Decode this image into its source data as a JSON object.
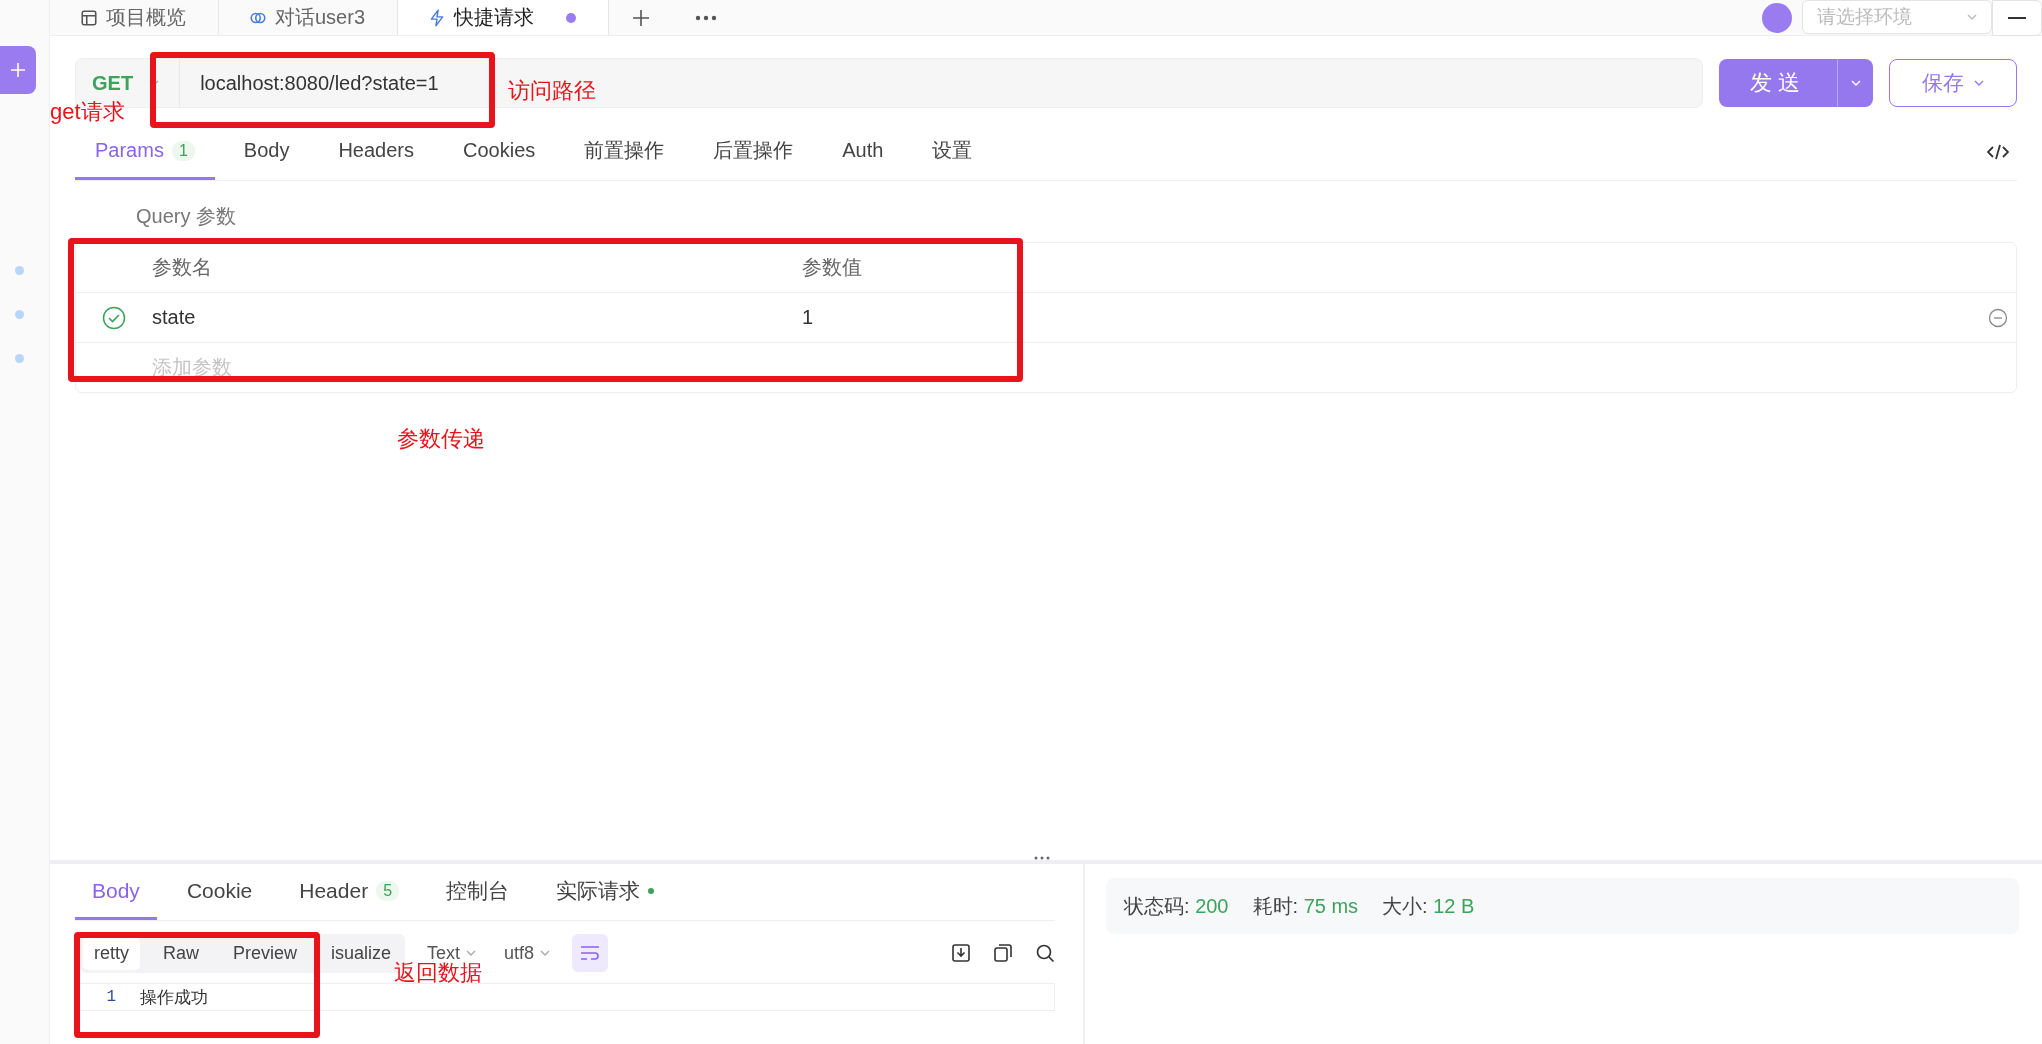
{
  "top_tabs": [
    {
      "label": "项目概览",
      "kind": "overview",
      "selected": false,
      "unsaved": false
    },
    {
      "label": "对话user3",
      "kind": "conversation",
      "selected": false,
      "unsaved": false
    },
    {
      "label": "快捷请求",
      "kind": "quick_request",
      "selected": true,
      "unsaved": true
    }
  ],
  "env_select": {
    "placeholder": "请选择环境"
  },
  "request": {
    "method": "GET",
    "url": "localhost:8080/led?state=1",
    "send_label": "发送",
    "save_label": "保存"
  },
  "request_tabs": [
    {
      "label": "Params",
      "badge": "1",
      "selected": true
    },
    {
      "label": "Body",
      "selected": false
    },
    {
      "label": "Headers",
      "selected": false
    },
    {
      "label": "Cookies",
      "selected": false
    },
    {
      "label": "前置操作",
      "selected": false
    },
    {
      "label": "后置操作",
      "selected": false
    },
    {
      "label": "Auth",
      "selected": false
    },
    {
      "label": "设置",
      "selected": false
    }
  ],
  "query": {
    "title": "Query 参数",
    "columns": [
      "参数名",
      "参数值"
    ],
    "rows": [
      {
        "name": "state",
        "value": "1",
        "enabled": true
      }
    ],
    "add_placeholder": "添加参数"
  },
  "response_tabs": [
    {
      "label": "Body",
      "selected": true,
      "dot": false
    },
    {
      "label": "Cookie",
      "selected": false,
      "dot": false
    },
    {
      "label": "Header",
      "badge": "5",
      "selected": false,
      "dot": false
    },
    {
      "label": "控制台",
      "selected": false,
      "dot": false
    },
    {
      "label": "实际请求",
      "selected": false,
      "dot": true
    }
  ],
  "view_modes": [
    {
      "label": "retty",
      "selected": true
    },
    {
      "label": "Raw",
      "selected": false
    },
    {
      "label": "Preview",
      "selected": false
    },
    {
      "label": "isualize",
      "selected": false
    }
  ],
  "format": "Text",
  "encoding": "utf8",
  "wrap_on": true,
  "editor_lines": [
    {
      "number": "1",
      "text": "操作成功"
    }
  ],
  "status": [
    {
      "label": "状态码:",
      "value": "200"
    },
    {
      "label": "耗时:",
      "value": "75 ms"
    },
    {
      "label": "大小:",
      "value": "12 B"
    }
  ],
  "annotations": [
    "get请求",
    "访问路径",
    "参数传递",
    "返回数据"
  ]
}
